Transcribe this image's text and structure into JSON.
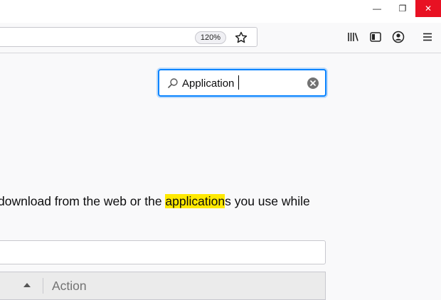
{
  "window": {
    "minimize_glyph": "—",
    "maximize_glyph": "❐",
    "close_glyph": "✕"
  },
  "toolbar": {
    "zoom_level": "120%",
    "icons": [
      "star-icon",
      "library-icon",
      "sidebar-icon",
      "account-icon",
      "menu-icon"
    ]
  },
  "search": {
    "value": "Application",
    "accent": "#0a84ff"
  },
  "main": {
    "description_before": "download from the web or the ",
    "description_highlight": "application",
    "description_after": "s you use while",
    "highlight_color": "#ffe900"
  },
  "table": {
    "columns": [
      {
        "label": ""
      },
      {
        "label": "Action"
      }
    ]
  }
}
